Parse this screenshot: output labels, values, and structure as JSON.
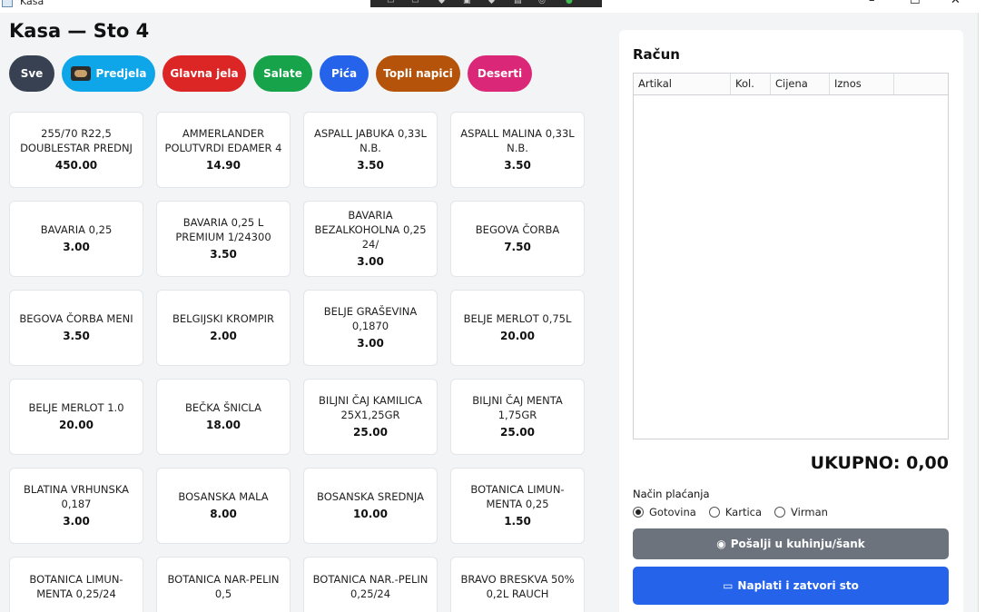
{
  "window": {
    "title": "Kasa",
    "controls": {
      "minimize": "–",
      "maximize": "☐",
      "close": "✕"
    }
  },
  "page": {
    "title": "Kasa — Sto 4"
  },
  "categories": [
    {
      "label": "Sve",
      "color": "#374151"
    },
    {
      "label": "Predjela",
      "color": "#0ea5e9",
      "has_image": true
    },
    {
      "label": "Glavna jela",
      "color": "#dc2626"
    },
    {
      "label": "Salate",
      "color": "#16a34a"
    },
    {
      "label": "Pića",
      "color": "#2563eb"
    },
    {
      "label": "Topli napici",
      "color": "#b45309"
    },
    {
      "label": "Deserti",
      "color": "#db2777"
    }
  ],
  "products": [
    {
      "name": "255/70 R22,5 DOUBLESTAR PREDNJ",
      "price": "450.00"
    },
    {
      "name": "AMMERLANDER POLUTVRDI EDAMER 4",
      "price": "14.90"
    },
    {
      "name": "ASPALL JABUKA 0,33L N.B.",
      "price": "3.50"
    },
    {
      "name": "ASPALL MALINA 0,33L N.B.",
      "price": "3.50"
    },
    {
      "name": "BAVARIA 0,25",
      "price": "3.00"
    },
    {
      "name": "BAVARIA 0,25 L PREMIUM 1/24300",
      "price": "3.50"
    },
    {
      "name": "BAVARIA BEZALKOHOLNA 0,25 24/",
      "price": "3.00"
    },
    {
      "name": "BEGOVA ČORBA",
      "price": "7.50"
    },
    {
      "name": "BEGOVA ČORBA MENI",
      "price": "3.50"
    },
    {
      "name": "BELGIJSKI KROMPIR",
      "price": "2.00"
    },
    {
      "name": "BELJE GRAŠEVINA 0,1870",
      "price": "3.00"
    },
    {
      "name": "BELJE MERLOT 0,75L",
      "price": "20.00"
    },
    {
      "name": "BELJE MERLOT 1.0",
      "price": "20.00"
    },
    {
      "name": "BEČKA ŠNICLA",
      "price": "18.00"
    },
    {
      "name": "BILJNI ČAJ KAMILICA 25X1,25GR",
      "price": "25.00"
    },
    {
      "name": "BILJNI ČAJ MENTA 1,75GR",
      "price": "25.00"
    },
    {
      "name": "BLATINA VRHUNSKA 0,187",
      "price": "3.00"
    },
    {
      "name": "BOSANSKA MALA",
      "price": "8.00"
    },
    {
      "name": "BOSANSKA SREDNJA",
      "price": "10.00"
    },
    {
      "name": "BOTANICA LIMUN-MENTA 0,25",
      "price": "1.50"
    },
    {
      "name": "BOTANICA LIMUN-MENTA 0,25/24",
      "price": ""
    },
    {
      "name": "BOTANICA NAR-PELIN 0,5",
      "price": ""
    },
    {
      "name": "BOTANICA NAR.-PELIN 0,25/24",
      "price": ""
    },
    {
      "name": "BRAVO BRESKVA 50% 0,2L RAUCH",
      "price": ""
    }
  ],
  "receipt": {
    "title": "Račun",
    "columns": [
      "Artikal",
      "Kol.",
      "Cijena",
      "Iznos"
    ],
    "rows": [],
    "total": "UKUPNO: 0,00",
    "payment_label": "Način plaćanja",
    "payment_options": [
      {
        "label": "Gotovina",
        "selected": true
      },
      {
        "label": "Kartica",
        "selected": false
      },
      {
        "label": "Virman",
        "selected": false
      }
    ],
    "send_button": "Pošalji u kuhinju/šank",
    "pay_button": "Naplati i zatvori sto"
  }
}
